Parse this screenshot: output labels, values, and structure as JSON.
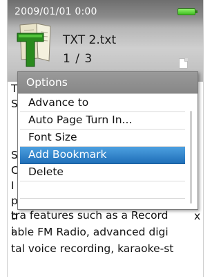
{
  "status_bar": {
    "datetime": "2009/01/01   0:00",
    "battery_icon": "battery-full-icon",
    "battery_color": "#4cd22a"
  },
  "file_header": {
    "file_name": "TXT 2.txt",
    "page_counter": "1 / 3",
    "app_icon": "text-reader-icon",
    "doc_icon": "document-icon"
  },
  "book_text": {
    "edge_left": [
      "T",
      "S",
      "S",
      "C",
      "I",
      "p",
      "u",
      "i",
      "h"
    ],
    "edge_right": [
      "x"
    ],
    "lines": [
      "tra features such as a Record",
      "able FM Radio, advanced digi",
      "tal voice recording, karaoke-st"
    ]
  },
  "options_menu": {
    "title": "Options",
    "items": [
      {
        "label": "Advance to",
        "selected": false
      },
      {
        "label": "Auto Page Turn In...",
        "selected": false
      },
      {
        "label": "Font Size",
        "selected": false
      },
      {
        "label": "Add Bookmark",
        "selected": true
      },
      {
        "label": "Delete",
        "selected": false
      }
    ],
    "selection_color": "#2e86d0"
  }
}
